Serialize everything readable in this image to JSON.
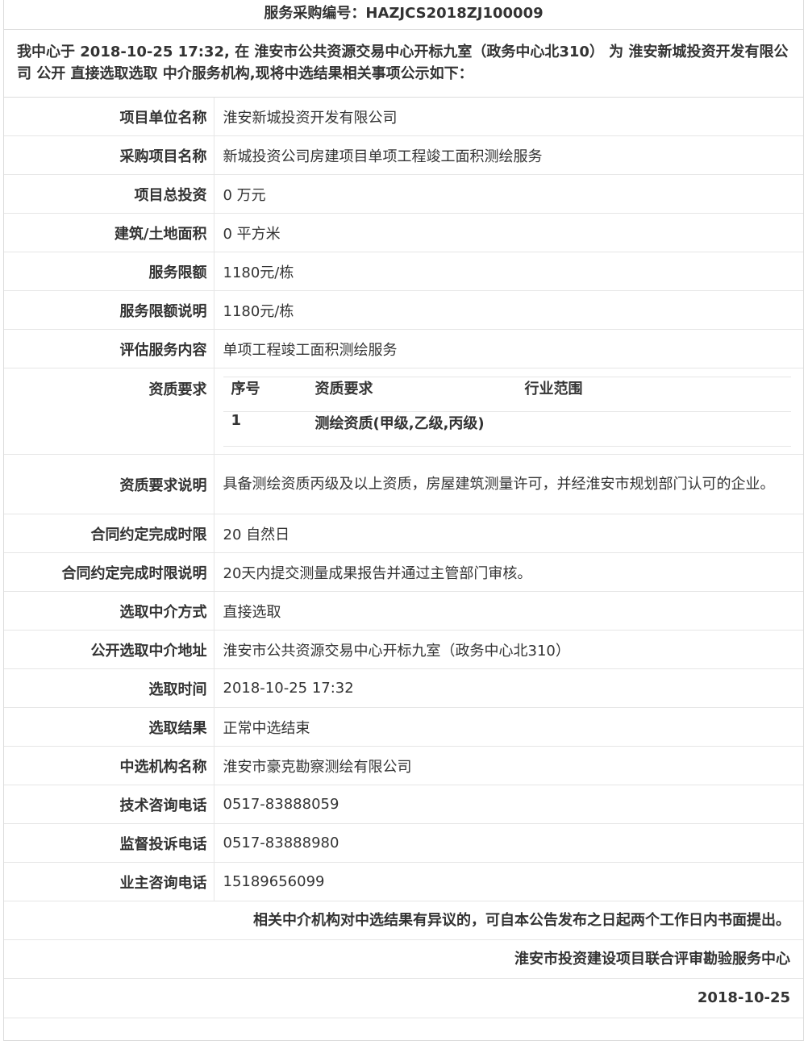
{
  "header": {
    "title": "服务采购编号：HAZJCS2018ZJ100009",
    "intro": "我中心于 2018-10-25 17:32, 在 淮安市公共资源交易中心开标九室（政务中心北310） 为 淮安新城投资开发有限公司 公开 直接选取选取 中介服务机构,现将中选结果相关事项公示如下："
  },
  "rows": [
    {
      "label": "项目单位名称",
      "value": "淮安新城投资开发有限公司"
    },
    {
      "label": "采购项目名称",
      "value": "新城投资公司房建项目单项工程竣工面积测绘服务"
    },
    {
      "label": "项目总投资",
      "value": "0 万元"
    },
    {
      "label": "建筑/土地面积",
      "value": "0 平方米"
    },
    {
      "label": "服务限额",
      "value": "1180元/栋"
    },
    {
      "label": "服务限额说明",
      "value": "1180元/栋"
    },
    {
      "label": "评估服务内容",
      "value": "单项工程竣工面积测绘服务"
    }
  ],
  "qualification": {
    "label": "资质要求",
    "headers": [
      "序号",
      "资质要求",
      "行业范围"
    ],
    "rows": [
      {
        "no": "1",
        "requirement": "测绘资质(甲级,乙级,丙级)",
        "scope": ""
      }
    ]
  },
  "qual_note": {
    "label": "资质要求说明",
    "value": "具备测绘资质丙级及以上资质，房屋建筑测量许可，并经淮安市规划部门认可的企业。"
  },
  "rows2": [
    {
      "label": "合同约定完成时限",
      "value": "20 自然日"
    },
    {
      "label": "合同约定完成时限说明",
      "value": "20天内提交测量成果报告并通过主管部门审核。"
    },
    {
      "label": "选取中介方式",
      "value": "直接选取"
    },
    {
      "label": "公开选取中介地址",
      "value": "淮安市公共资源交易中心开标九室（政务中心北310）"
    },
    {
      "label": "选取时间",
      "value": "2018-10-25 17:32"
    },
    {
      "label": "选取结果",
      "value": "正常中选结束"
    },
    {
      "label": "中选机构名称",
      "value": "淮安市豪克勘察测绘有限公司"
    },
    {
      "label": "技术咨询电话",
      "value": "0517-83888059"
    },
    {
      "label": "监督投诉电话",
      "value": "0517-83888980"
    },
    {
      "label": "业主咨询电话",
      "value": "15189656099"
    }
  ],
  "footer": {
    "notice": "相关中介机构对中选结果有异议的，可自本公告发布之日起两个工作日内书面提出。",
    "org": "淮安市投资建设项目联合评审勘验服务中心",
    "date": "2018-10-25"
  }
}
